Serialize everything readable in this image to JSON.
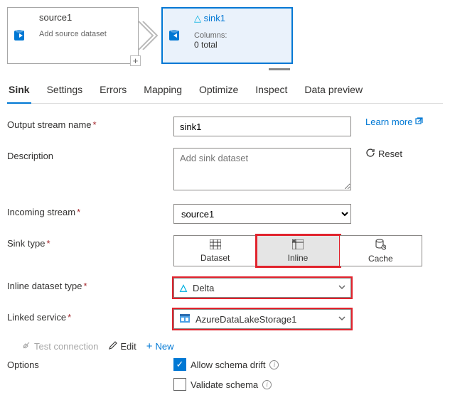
{
  "flow": {
    "source": {
      "title": "source1",
      "subtitle": "Add source dataset"
    },
    "sink": {
      "title": "sink1",
      "columns_label": "Columns:",
      "columns_count": "0 total"
    }
  },
  "tabs": {
    "sink": "Sink",
    "settings": "Settings",
    "errors": "Errors",
    "mapping": "Mapping",
    "optimize": "Optimize",
    "inspect": "Inspect",
    "preview": "Data preview"
  },
  "labels": {
    "output_stream": "Output stream name",
    "description": "Description",
    "incoming_stream": "Incoming stream",
    "sink_type": "Sink type",
    "inline_dataset_type": "Inline dataset type",
    "linked_service": "Linked service",
    "options": "Options"
  },
  "values": {
    "output_stream": "sink1",
    "description_placeholder": "Add sink dataset",
    "incoming_stream": "source1",
    "inline_dataset_type": "Delta",
    "linked_service": "AzureDataLakeStorage1"
  },
  "sink_type_options": {
    "dataset": "Dataset",
    "inline": "Inline",
    "cache": "Cache"
  },
  "actions": {
    "learn_more": "Learn more",
    "reset": "Reset",
    "test_connection": "Test connection",
    "edit": "Edit",
    "new": "New"
  },
  "options": {
    "allow_schema_drift": "Allow schema drift",
    "validate_schema": "Validate schema"
  }
}
